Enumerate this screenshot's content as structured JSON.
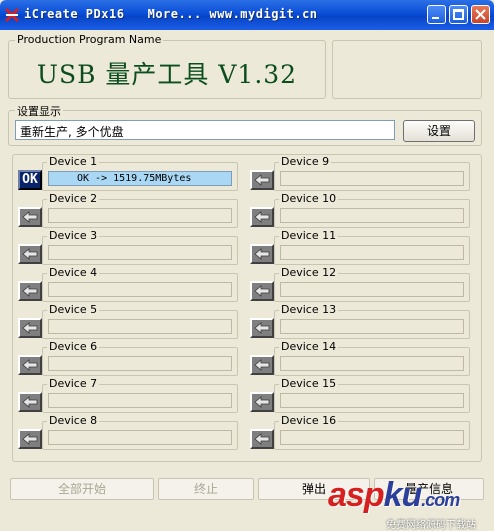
{
  "window": {
    "title": "iCreate PDx16   More... www.mydigit.cn"
  },
  "program_group": {
    "label": "Production Program Name",
    "title": "USB 量产工具 V1.32"
  },
  "settings_group": {
    "label": "设置显示",
    "value": "重新生产, 多个优盘",
    "button": "设置"
  },
  "devices": [
    {
      "label": "Device 1",
      "status": "OK",
      "text": "OK -> 1519.75MBytes"
    },
    {
      "label": "Device 2",
      "status": "",
      "text": ""
    },
    {
      "label": "Device 3",
      "status": "",
      "text": ""
    },
    {
      "label": "Device 4",
      "status": "",
      "text": ""
    },
    {
      "label": "Device 5",
      "status": "",
      "text": ""
    },
    {
      "label": "Device 6",
      "status": "",
      "text": ""
    },
    {
      "label": "Device 7",
      "status": "",
      "text": ""
    },
    {
      "label": "Device 8",
      "status": "",
      "text": ""
    },
    {
      "label": "Device 9",
      "status": "",
      "text": ""
    },
    {
      "label": "Device 10",
      "status": "",
      "text": ""
    },
    {
      "label": "Device 11",
      "status": "",
      "text": ""
    },
    {
      "label": "Device 12",
      "status": "",
      "text": ""
    },
    {
      "label": "Device 13",
      "status": "",
      "text": ""
    },
    {
      "label": "Device 14",
      "status": "",
      "text": ""
    },
    {
      "label": "Device 15",
      "status": "",
      "text": ""
    },
    {
      "label": "Device 16",
      "status": "",
      "text": ""
    }
  ],
  "buttons": {
    "start_all": "全部开始",
    "stop": "终止",
    "eject": "弹出",
    "production_info": "量产信息"
  },
  "watermark": {
    "brand_a": "asp",
    "brand_b": "ku",
    "brand_c": ".com",
    "sub": "免费网络源码下载站"
  },
  "colors": {
    "titlebar": "#0a4ed8",
    "ok_background": "#0a246a",
    "active_field": "#a9d7f4",
    "title_text": "#0b4d1c"
  }
}
